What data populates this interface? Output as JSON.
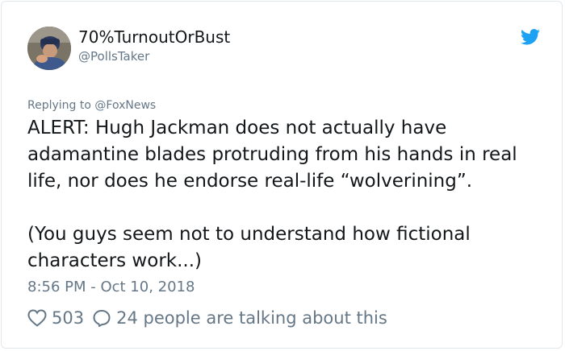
{
  "author": {
    "display_name": "70%TurnoutOrBust",
    "handle": "@PollsTaker",
    "avatar_icon": "profile-photo"
  },
  "brand": {
    "icon": "twitter-bird-icon",
    "color": "#1da1f2"
  },
  "tweet": {
    "reply_prefix": "Replying to ",
    "reply_to": "@FoxNews",
    "lines": [
      "ALERT: Hugh Jackman does not actually have",
      "adamantine blades protruding from his hands in real",
      "life, nor does he endorse real-life “wolverining”.",
      "",
      "(You guys seem not to understand how fictional",
      "characters work...)"
    ],
    "timestamp": "8:56 PM - Oct 10, 2018"
  },
  "stats": {
    "likes": "503",
    "talking": "24 people are talking about this"
  },
  "colors": {
    "text": "#14171a",
    "muted": "#657786",
    "link": "#1da1f2",
    "border": "#e1e8ed"
  }
}
